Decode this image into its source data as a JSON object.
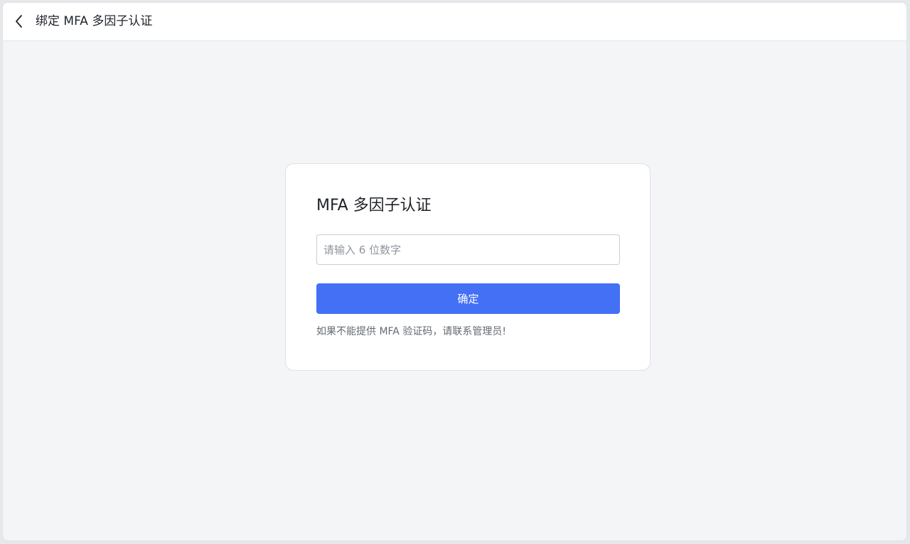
{
  "header": {
    "back_icon": "chevron-left-icon",
    "title": "绑定 MFA 多因子认证"
  },
  "card": {
    "title": "MFA 多因子认证",
    "code_input": {
      "value": "",
      "placeholder": "请输入 6 位数字"
    },
    "confirm_label": "确定",
    "help_text": "如果不能提供 MFA 验证码，请联系管理员!"
  },
  "colors": {
    "primary": "#4370f5",
    "background": "#f4f5f7",
    "card": "#ffffff",
    "text": "#1f2329",
    "muted_text": "#646a73"
  }
}
